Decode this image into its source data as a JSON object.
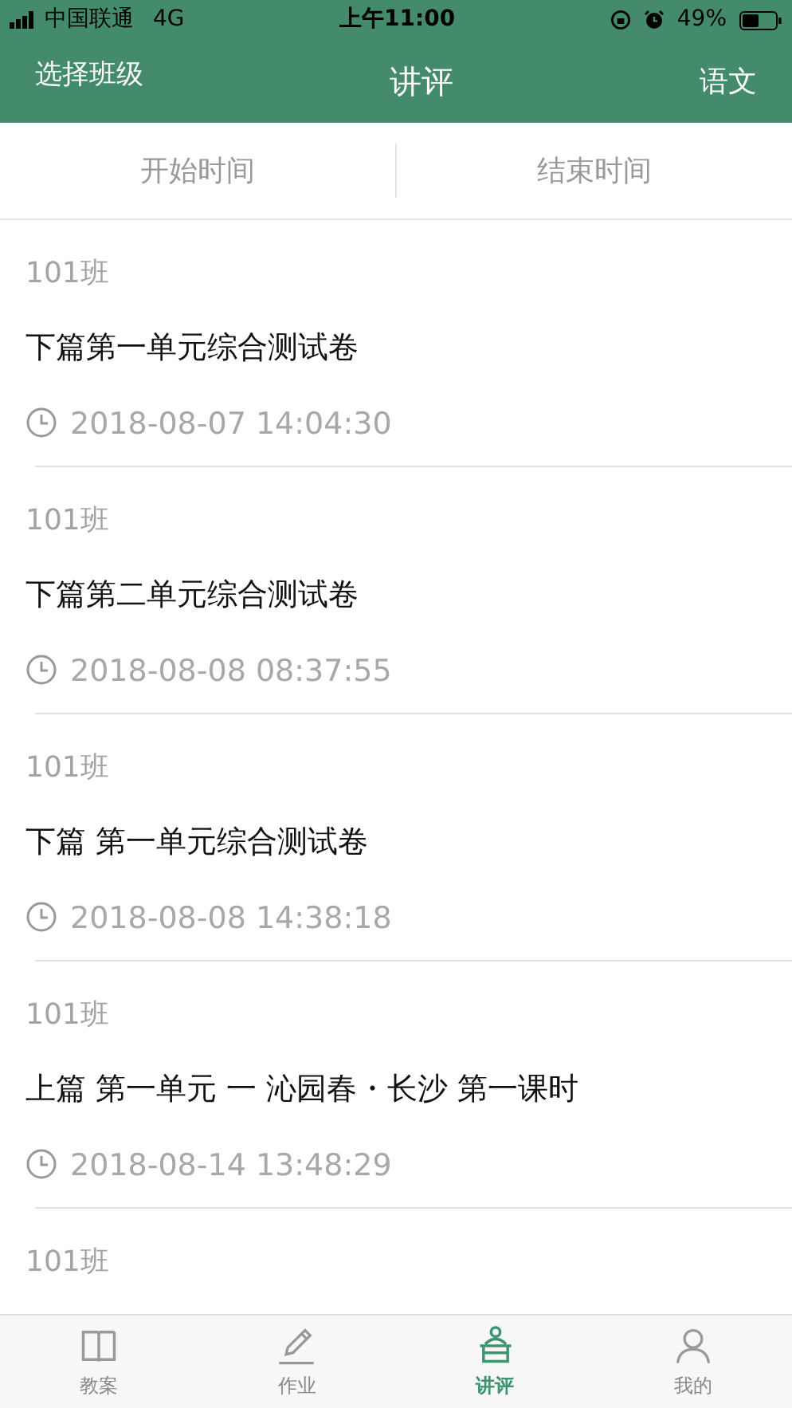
{
  "status_bar": {
    "carrier": "中国联通",
    "network": "4G",
    "time": "上午11:00",
    "battery": "49%"
  },
  "nav_bar": {
    "left": "选择班级",
    "title": "讲评",
    "right": "语文"
  },
  "filters": [
    {
      "label": "开始时间"
    },
    {
      "label": "结束时间"
    }
  ],
  "items": [
    {
      "class": "101班",
      "title": "下篇第一单元综合测试卷",
      "time": "2018-08-07 14:04:30"
    },
    {
      "class": "101班",
      "title": "下篇第二单元综合测试卷",
      "time": "2018-08-08 08:37:55"
    },
    {
      "class": "101班",
      "title": "下篇 第一单元综合测试卷",
      "time": "2018-08-08 14:38:18"
    },
    {
      "class": "101班",
      "title": "上篇 第一单元 一 沁园春・长沙 第一课时",
      "time": "2018-08-14 13:48:29"
    },
    {
      "class": "101班"
    }
  ],
  "tab_bar": [
    {
      "label": "教案",
      "kind": "book",
      "selected": false
    },
    {
      "label": "作业",
      "kind": "pencil",
      "selected": false
    },
    {
      "label": "讲评",
      "kind": "lectern",
      "selected": true
    },
    {
      "label": "我的",
      "kind": "person",
      "selected": false
    }
  ]
}
